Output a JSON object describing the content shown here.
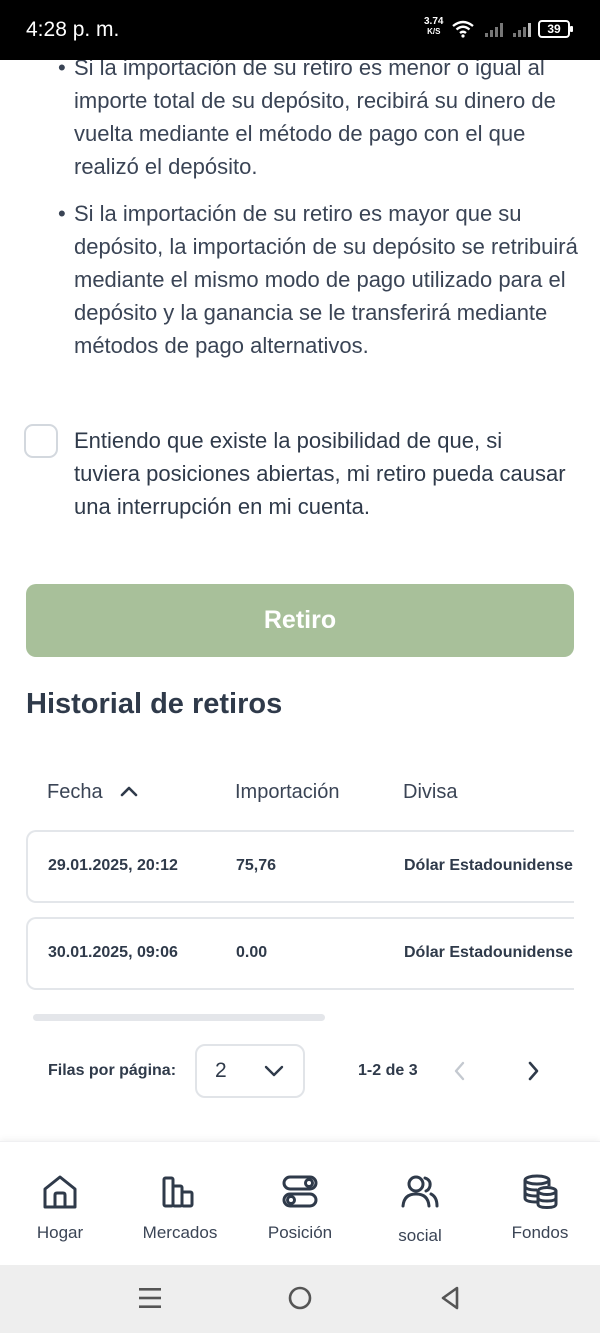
{
  "status_bar": {
    "time": "4:28 p. m.",
    "net_speed_value": "3.74",
    "net_speed_unit": "K/S",
    "battery": "39"
  },
  "info": {
    "bullet_1": "Si la importación de su retiro es menor o igual al importe total de su depósito, recibirá su dinero de vuelta mediante el método de pago con el que realizó el depósito.",
    "bullet_2": "Si la importación de su retiro es mayor que su depósito, la importación de su depósito se retribuirá mediante el mismo modo de pago utilizado para el depósito y la ganancia se le transferirá mediante métodos de pago alternativos."
  },
  "agreement": {
    "label": "Entiendo que existe la posibilidad de que, si tuviera posiciones abiertas, mi retiro pueda causar una interrupción en mi cuenta.",
    "checked": false
  },
  "withdraw_button": {
    "label": "Retiro",
    "color": "#a8c09a"
  },
  "history": {
    "title": "Historial de retiros",
    "columns": [
      "Fecha",
      "Importación",
      "Divisa"
    ],
    "sort_direction": "ascending",
    "rows": [
      {
        "date": "29.01.2025, 20:12",
        "amount": "75,76",
        "currency": "Dólar Estadounidense"
      },
      {
        "date": "30.01.2025, 09:06",
        "amount": "0.00",
        "currency": "Dólar Estadounidense"
      }
    ]
  },
  "pagination": {
    "rows_per_page_label": "Filas por página:",
    "rows_per_page_value": "2",
    "range_text": "1-2 de 3"
  },
  "bottom_nav": [
    {
      "label": "Hogar",
      "icon": "home-icon"
    },
    {
      "label": "Mercados",
      "icon": "bar-chart-icon"
    },
    {
      "label": "Posición",
      "icon": "toggles-icon"
    },
    {
      "label": "social",
      "icon": "users-icon"
    },
    {
      "label": "Fondos",
      "icon": "coins-icon"
    }
  ]
}
